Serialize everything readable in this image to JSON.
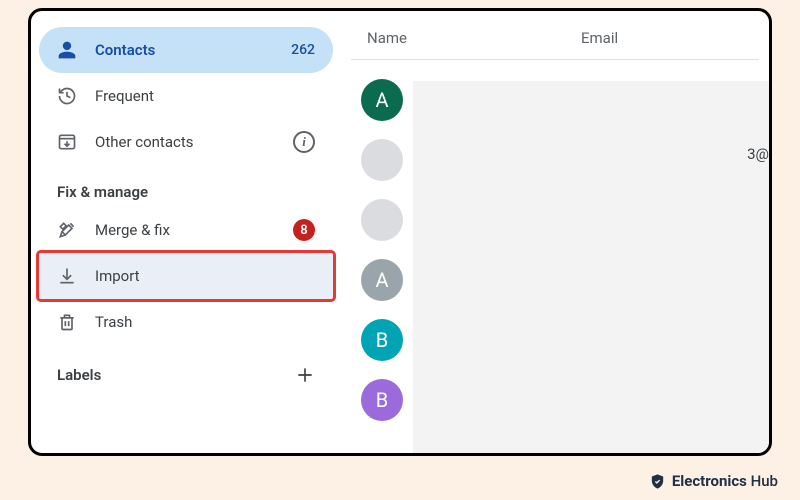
{
  "sidebar": {
    "contacts": {
      "label": "Contacts",
      "count": "262"
    },
    "frequent": {
      "label": "Frequent"
    },
    "other": {
      "label": "Other contacts"
    },
    "section": "Fix & manage",
    "merge": {
      "label": "Merge & fix",
      "badge": "8"
    },
    "import": {
      "label": "Import"
    },
    "trash": {
      "label": "Trash"
    },
    "labels": {
      "label": "Labels"
    }
  },
  "columns": {
    "name": "Name",
    "email": "Email"
  },
  "contacts": [
    {
      "kind": "letter",
      "letter": "A",
      "bg": "#0b6b4f"
    },
    {
      "kind": "photo",
      "style": "joker"
    },
    {
      "kind": "photo",
      "style": "guy"
    },
    {
      "kind": "letter",
      "letter": "A",
      "bg": "#9aa5ab"
    },
    {
      "kind": "letter",
      "letter": "B",
      "bg": "#00a4b4"
    },
    {
      "kind": "letter",
      "letter": "B",
      "bg": "#9b6bdc"
    }
  ],
  "clipped_email_fragment": "3@",
  "branding": {
    "text_bold": "Electronics",
    "text_rest": " Hub"
  }
}
